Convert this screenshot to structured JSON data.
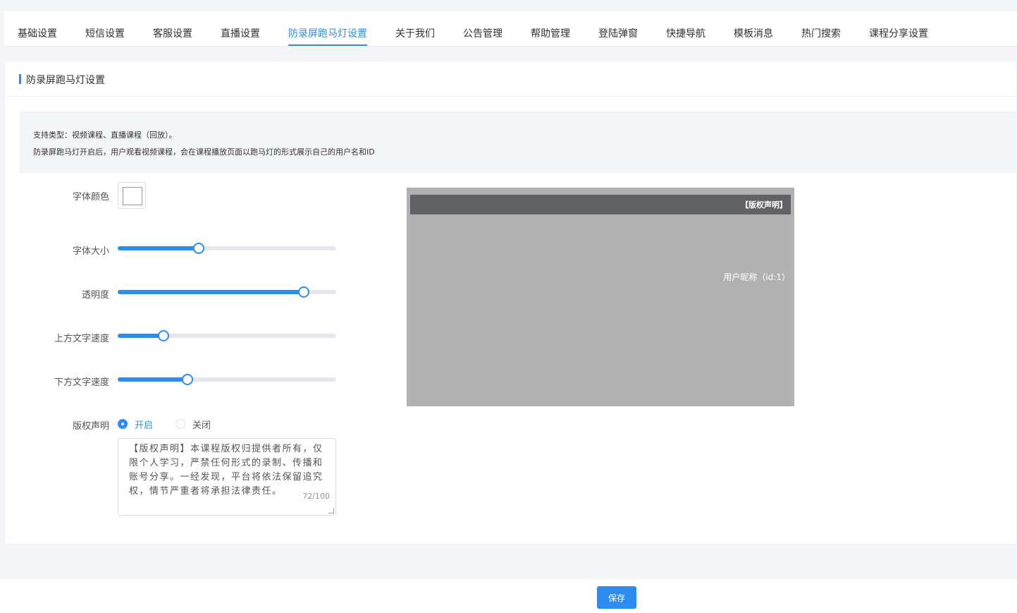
{
  "tabs": [
    {
      "label": "基础设置"
    },
    {
      "label": "短信设置"
    },
    {
      "label": "客服设置"
    },
    {
      "label": "直播设置"
    },
    {
      "label": "防录屏跑马灯设置",
      "active": true
    },
    {
      "label": "关于我们"
    },
    {
      "label": "公告管理"
    },
    {
      "label": "帮助管理"
    },
    {
      "label": "登陆弹窗"
    },
    {
      "label": "快捷导航"
    },
    {
      "label": "模板消息"
    },
    {
      "label": "热门搜索"
    },
    {
      "label": "课程分享设置"
    }
  ],
  "card": {
    "title": "防录屏跑马灯设置",
    "notice": [
      "支持类型：视频课程、直播课程（回放）。",
      "防录屏跑马灯开启后，用户观看视频课程，会在课程播放页面以跑马灯的形式展示自己的用户名和ID"
    ]
  },
  "form": {
    "font_color": {
      "label": "字体颜色",
      "value": "#ffffff"
    },
    "font_size": {
      "label": "字体大小",
      "percent": 37
    },
    "opacity": {
      "label": "透明度",
      "percent": 85
    },
    "top_speed": {
      "label": "上方文字速度",
      "percent": 21
    },
    "bottom_speed": {
      "label": "下方文字速度",
      "percent": 32
    },
    "copyright": {
      "label": "版权声明",
      "on_label": "开启",
      "off_label": "关闭",
      "selected": "on",
      "text": "【版权声明】本课程版权归提供者所有，仅限个人学习，严禁任何形式的录制、传播和账号分享。一经发现，平台将依法保留追究权，情节严重者将承担法律责任。",
      "counter": "72/100"
    }
  },
  "preview": {
    "top_text": "【版权声明】",
    "user_text": "用户昵称（id:1）"
  },
  "footer": {
    "save_label": "保存"
  },
  "colors": {
    "accent": "#2d8cf0",
    "preview_bg": "#b1b1b1",
    "preview_bar": "#616265"
  }
}
